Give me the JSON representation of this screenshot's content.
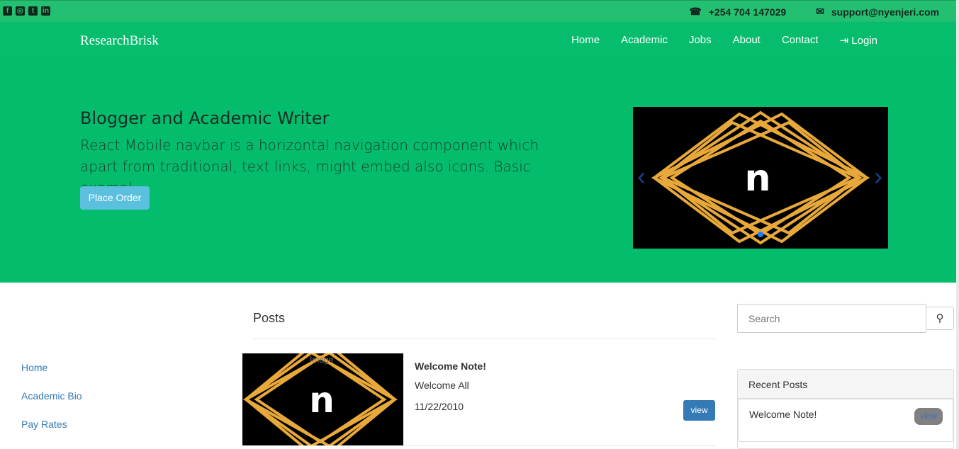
{
  "topbar": {
    "social_icons": [
      "facebook-icon",
      "instagram-icon",
      "twitter-icon",
      "linkedin-icon"
    ],
    "phone": "+254 704 147029",
    "email": "support@nyenjeri.com"
  },
  "navbar": {
    "brand": "ResearchBrisk",
    "links": [
      "Home",
      "Academic",
      "Jobs",
      "About",
      "Contact"
    ],
    "login": "Login"
  },
  "hero": {
    "title": "Blogger and Academic Writer",
    "text": "React Mobile navbar is a horizontal navigation component which apart from traditional, text links, might embed also icons. Basic exampl",
    "button": "Place Order",
    "carousel_letter": "n"
  },
  "sidebar": {
    "links": [
      "Home",
      "Academic Bio",
      "Pay Rates"
    ]
  },
  "posts": {
    "title": "Posts",
    "items": [
      {
        "image_alt": "Image",
        "image_letter": "n",
        "title": "Welcome Note!",
        "body": "Welcome All",
        "date": "11/22/2010",
        "button": "view"
      }
    ]
  },
  "right": {
    "search_placeholder": "Search",
    "recent_title": "Recent Posts",
    "recent_items": [
      {
        "title": "Welcome Note!",
        "button": "view"
      }
    ]
  },
  "colors": {
    "topbar": "#23c072",
    "navbar": "#05bd6c",
    "hero": "#03bc6c",
    "primary": "#337ab7",
    "info": "#5bc0de",
    "logo_gold": "#e8a93a"
  }
}
